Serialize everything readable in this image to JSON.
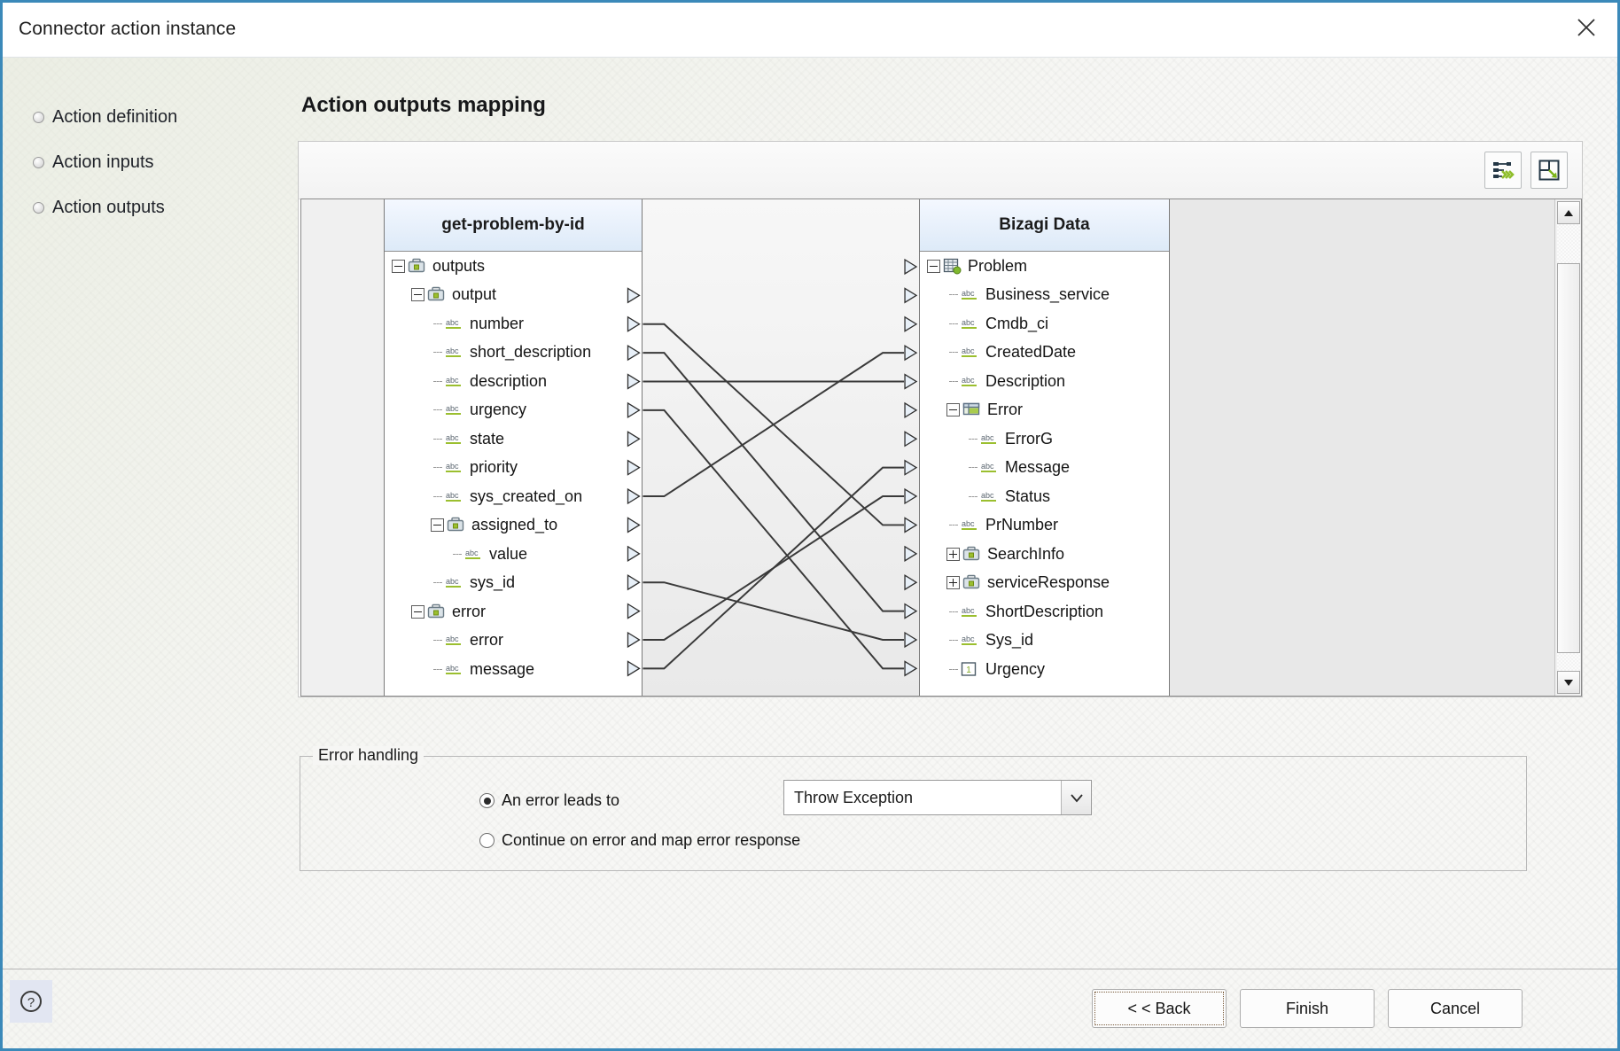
{
  "window": {
    "title": "Connector action instance",
    "close_icon": "close-icon"
  },
  "wizard_nav": {
    "items": [
      {
        "label": "Action definition"
      },
      {
        "label": "Action inputs"
      },
      {
        "label": "Action outputs"
      }
    ]
  },
  "page": {
    "title": "Action outputs mapping"
  },
  "mapper": {
    "toolbar": {
      "automap_icon": "auto-map-icon",
      "fit_icon": "expand-to-fit-icon"
    },
    "left_tree": {
      "header": "get-problem-by-id",
      "rows": [
        {
          "label": "outputs",
          "depth": 0,
          "icon": "briefcase-icon",
          "expander": "minus"
        },
        {
          "label": "output",
          "depth": 1,
          "icon": "briefcase-icon",
          "expander": "minus"
        },
        {
          "label": "number",
          "depth": 2,
          "icon": "abc-icon",
          "expander": "none"
        },
        {
          "label": "short_description",
          "depth": 2,
          "icon": "abc-icon",
          "expander": "none"
        },
        {
          "label": "description",
          "depth": 2,
          "icon": "abc-icon",
          "expander": "none"
        },
        {
          "label": "urgency",
          "depth": 2,
          "icon": "abc-icon",
          "expander": "none"
        },
        {
          "label": "state",
          "depth": 2,
          "icon": "abc-icon",
          "expander": "none"
        },
        {
          "label": "priority",
          "depth": 2,
          "icon": "abc-icon",
          "expander": "none"
        },
        {
          "label": "sys_created_on",
          "depth": 2,
          "icon": "abc-icon",
          "expander": "none"
        },
        {
          "label": "assigned_to",
          "depth": 2,
          "icon": "briefcase-icon",
          "expander": "minus"
        },
        {
          "label": "value",
          "depth": 3,
          "icon": "abc-icon",
          "expander": "none"
        },
        {
          "label": "sys_id",
          "depth": 2,
          "icon": "abc-icon",
          "expander": "none"
        },
        {
          "label": "error",
          "depth": 1,
          "icon": "briefcase-icon",
          "expander": "minus"
        },
        {
          "label": "error",
          "depth": 2,
          "icon": "abc-icon",
          "expander": "none"
        },
        {
          "label": "message",
          "depth": 2,
          "icon": "abc-icon",
          "expander": "none"
        }
      ]
    },
    "right_tree": {
      "header": "Bizagi Data",
      "rows": [
        {
          "label": "Problem",
          "depth": 0,
          "icon": "entity-icon",
          "expander": "minus"
        },
        {
          "label": "Business_service",
          "depth": 1,
          "icon": "abc-icon",
          "expander": "none"
        },
        {
          "label": "Cmdb_ci",
          "depth": 1,
          "icon": "abc-icon",
          "expander": "none"
        },
        {
          "label": "CreatedDate",
          "depth": 1,
          "icon": "abc-icon",
          "expander": "none"
        },
        {
          "label": "Description",
          "depth": 1,
          "icon": "abc-icon",
          "expander": "none"
        },
        {
          "label": "Error",
          "depth": 1,
          "icon": "table-icon",
          "expander": "minus"
        },
        {
          "label": "ErrorG",
          "depth": 2,
          "icon": "abc-icon",
          "expander": "none"
        },
        {
          "label": "Message",
          "depth": 2,
          "icon": "abc-icon",
          "expander": "none"
        },
        {
          "label": "Status",
          "depth": 2,
          "icon": "abc-icon",
          "expander": "none"
        },
        {
          "label": "PrNumber",
          "depth": 1,
          "icon": "abc-icon",
          "expander": "none"
        },
        {
          "label": "SearchInfo",
          "depth": 1,
          "icon": "briefcase-icon",
          "expander": "plus"
        },
        {
          "label": "serviceResponse",
          "depth": 1,
          "icon": "briefcase-icon",
          "expander": "plus"
        },
        {
          "label": "ShortDescription",
          "depth": 1,
          "icon": "abc-icon",
          "expander": "none"
        },
        {
          "label": "Sys_id",
          "depth": 1,
          "icon": "abc-icon",
          "expander": "none"
        },
        {
          "label": "Urgency",
          "depth": 1,
          "icon": "number-icon",
          "expander": "none"
        }
      ]
    },
    "mappings": [
      {
        "from": "number",
        "to": "PrNumber"
      },
      {
        "from": "short_description",
        "to": "ShortDescription"
      },
      {
        "from": "description",
        "to": "Description"
      },
      {
        "from": "urgency",
        "to": "Urgency"
      },
      {
        "from": "sys_created_on",
        "to": "CreatedDate"
      },
      {
        "from": "sys_id",
        "to": "Sys_id"
      },
      {
        "from": "error",
        "to": "Status"
      },
      {
        "from": "message",
        "to": "Message"
      }
    ],
    "scrollbar": {
      "up_icon": "scroll-up-icon",
      "down_icon": "scroll-down-icon"
    }
  },
  "error_handling": {
    "legend": "Error handling",
    "option_throw_label": "An error leads to",
    "option_continue_label": "Continue on error and map error response",
    "selected_option": "throw",
    "select_value": "Throw Exception",
    "select_arrow_icon": "chevron-down-icon"
  },
  "footer": {
    "help_icon": "help-icon",
    "back_label": "< < Back",
    "finish_label": "Finish",
    "cancel_label": "Cancel"
  }
}
